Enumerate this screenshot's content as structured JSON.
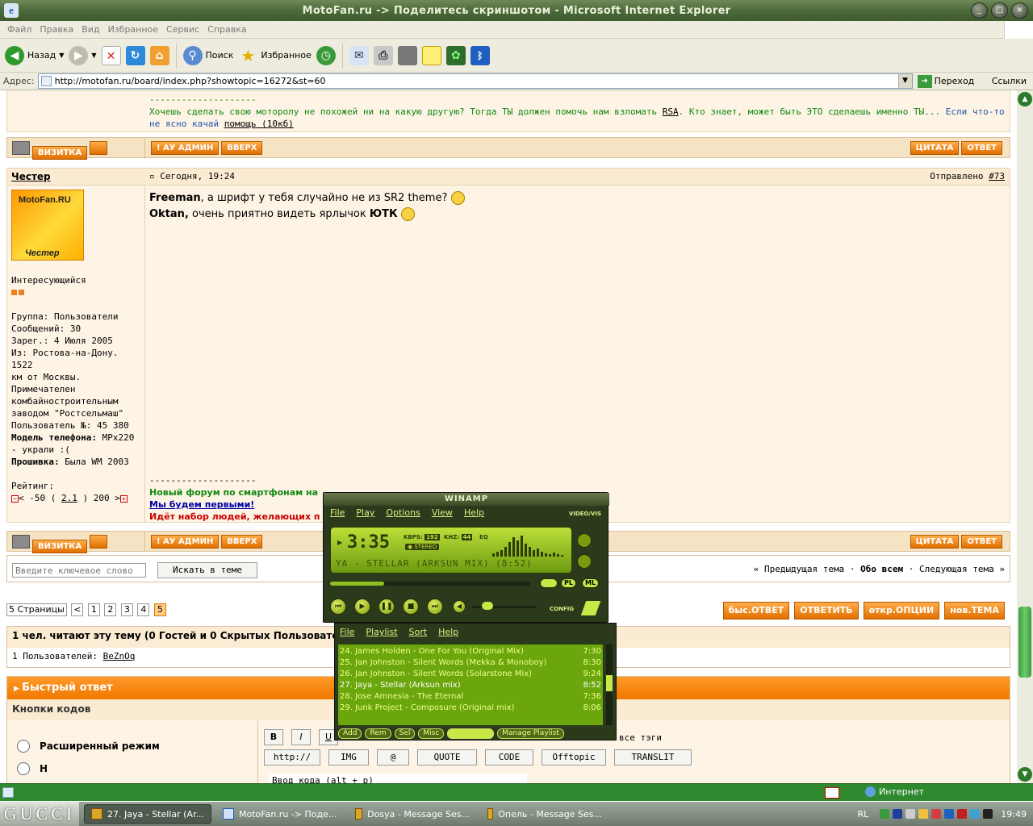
{
  "window": {
    "title": "MotoFan.ru -> Поделитесь скриншотом - Microsoft Internet Explorer"
  },
  "menu": [
    "Файл",
    "Правка",
    "Вид",
    "Избранное",
    "Сервис",
    "Справка"
  ],
  "toolbar": {
    "back": "Назад",
    "search": "Поиск",
    "favorites": "Избранное"
  },
  "address": {
    "label": "Адрес:",
    "url": "http://motofan.ru/board/index.php?showtopic=16272&st=60",
    "go": "Переход",
    "links": "Ссылки"
  },
  "post_prev": {
    "sep": "--------------------",
    "text1": "Хочешь сделать свою моторолу не похожей ни на какую другую? Тогда ТЫ должен помочь нам взломать ",
    "link1": "RSA",
    "text2": ". Кто знает, может быть ЭТО сделаешь именно ТЫ... ",
    "text3": "Если что-то не ясно качай ",
    "link2": "помощь (10кб)"
  },
  "actions": {
    "card": "ВИЗИТКА",
    "admin": "! АУ АДМИН",
    "up": "ВВЕРХ",
    "quote": "ЦИТАТА",
    "reply": "ОТВЕТ"
  },
  "post": {
    "author": "Честер",
    "date": "Сегодня, 19:24",
    "sent_label": "Отправлено ",
    "num": "#73",
    "avatar_top": "MotoFan.RU",
    "avatar_bottom": "Честер",
    "rank": "Интересующийся",
    "info": [
      "Группа: Пользователи",
      "Сообщений: 30",
      "Зарег.: 4 Июля 2005",
      "Из: Ростова-на-Дону. 1522",
      "км от Москвы.",
      "Примечателен",
      "комбайностроительным",
      "заводом \"Ростсельмаш\"",
      "Пользователь №: 45 380"
    ],
    "phone_label": "Модель телефона:",
    "phone_val": " MPx220",
    "phone_val2": "- украли :(",
    "fw_label": "Прошивка:",
    "fw_val": " Была WM 2003",
    "rating_label": "Рейтинг:",
    "rating_a": "< -50 ( ",
    "rating_link": "2.1",
    "rating_b": " ) 200 >",
    "line1_b": "Freeman",
    "line1": ", а шрифт у тебя случайно не из SR2 theme? ",
    "line2_b": "Oktan,",
    "line2": " очень приятно видеть ярлычок ",
    "line2_b2": "ЮТК",
    "sig_sep": "--------------------",
    "sig1": "Новый форум по смартфонам на",
    "sig2": "Мы будем первыми!",
    "sig3": "Идёт набор людей, желающих п"
  },
  "search": {
    "placeholder": "Введите ключевое слово",
    "button": "Искать в теме"
  },
  "topicnav": {
    "prev": "« Предыдущая тема",
    "sep": " · ",
    "all": "Обо всем",
    "next": "Следующая тема »"
  },
  "pagination": {
    "label": "5 Страницы",
    "prev": "<",
    "pages": [
      "1",
      "2",
      "3",
      "4",
      "5"
    ],
    "current": "5"
  },
  "bottom_buttons": [
    "быс.ОТВЕТ",
    "ОТВЕТИТЬ",
    "откр.ОПЦИИ",
    "нов.ТЕМА"
  ],
  "readers": {
    "title": "1 чел. читают эту тему (0 Гостей и 0 Скрытых Пользовате",
    "users_label": "1 Пользователей: ",
    "user": "BeZnOq"
  },
  "quickreply": {
    "title": "Быстрый ответ",
    "codes": "Кнопки кодов",
    "mode1": "Расширенный режим",
    "mode2": "Н",
    "all_tags": "все тэги",
    "tag_buttons": [
      "http://",
      "IMG",
      "@",
      "QUOTE",
      "CODE",
      "Offtopic",
      "TRANSLIT"
    ],
    "fmt": [
      "B",
      "I",
      "U"
    ],
    "code_hint": "Ввод кода (alt + p)"
  },
  "winamp": {
    "title": "WINAMP",
    "menu": [
      "File",
      "Play",
      "Options",
      "View",
      "Help"
    ],
    "time": "3:35",
    "kbps": "192",
    "khz": "44",
    "kbps_label": "KBPS:",
    "khz_label": "KHZ:",
    "stereo": "STEREO",
    "eq": "EQ",
    "marquee": "YA - STELLAR (ARKSUN MIX) (8:52)",
    "vis": "VIDEO/VIS",
    "pl": "PL",
    "ml": "ML",
    "config": "CONFIG",
    "seek_fraction": 0.27
  },
  "playlist": {
    "menu": [
      "File",
      "Playlist",
      "Sort",
      "Help"
    ],
    "items": [
      {
        "t": "24. James Holden - One For You (Original Mix)",
        "d": "7:30"
      },
      {
        "t": "25. Jan Johnston - Silent Words (Mekka & Monoboy)",
        "d": "8:30"
      },
      {
        "t": "26. Jan Johnston - Silent Words (Solarstone Mix)",
        "d": "9:24"
      },
      {
        "t": "27. Jaya - Stellar (Arksun mix)",
        "d": "8:52"
      },
      {
        "t": "28. Jose Amnesia - The Eternal",
        "d": "7:36"
      },
      {
        "t": "29. Junk Project - Composure (Original mix)",
        "d": "8:06"
      }
    ],
    "buttons": [
      "Add",
      "Rem",
      "Sel",
      "Misc",
      "Manage Playlist"
    ]
  },
  "status": {
    "zone": "Интернет"
  },
  "taskbar": {
    "start": "GUCCI",
    "tasks": [
      "27. Jaya - Stellar (Ar...",
      "MotoFan.ru -> Поде...",
      "Dosya - Message Ses...",
      "Опель - Message Ses..."
    ],
    "lang": "RL",
    "clock": "19:49"
  }
}
